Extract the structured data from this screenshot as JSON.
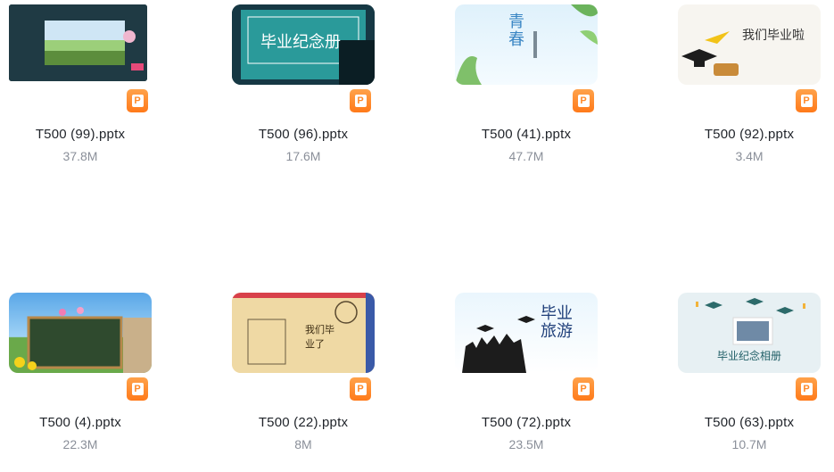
{
  "files": [
    {
      "name": "T500 (99).pptx",
      "size": "37.8M",
      "badge": "P",
      "thumb_text": ""
    },
    {
      "name": "T500 (96).pptx",
      "size": "17.6M",
      "badge": "P",
      "thumb_text": "毕业纪念册"
    },
    {
      "name": "T500 (41).pptx",
      "size": "47.7M",
      "badge": "P",
      "thumb_text": "青春"
    },
    {
      "name": "T500 (92).pptx",
      "size": "3.4M",
      "badge": "P",
      "thumb_text": "我们毕业啦"
    },
    {
      "name": "T500 (4).pptx",
      "size": "22.3M",
      "badge": "P",
      "thumb_text": ""
    },
    {
      "name": "T500 (22).pptx",
      "size": "8M",
      "badge": "P",
      "thumb_text": "我们毕业了"
    },
    {
      "name": "T500 (72).pptx",
      "size": "23.5M",
      "badge": "P",
      "thumb_text": "毕业旅游"
    },
    {
      "name": "T500 (63).pptx",
      "size": "10.7M",
      "badge": "P",
      "thumb_text": "毕业纪念相册"
    }
  ],
  "colors": {
    "badge": "#ff8a2a",
    "name": "#1f2329",
    "size": "#8a8f99"
  }
}
